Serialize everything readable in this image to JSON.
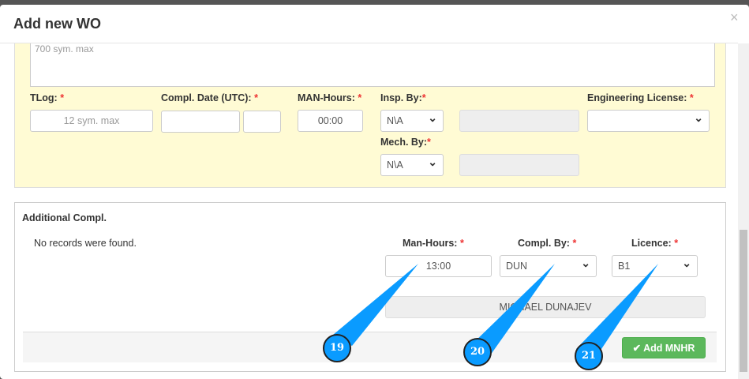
{
  "modal": {
    "title": "Add new WO",
    "close": "×"
  },
  "main": {
    "description_placeholder": "700 sym. max",
    "tlog": {
      "label": "TLog:",
      "req": "*",
      "placeholder": "12 sym. max"
    },
    "compl_date": {
      "label": "Compl. Date (UTC):",
      "req": "*"
    },
    "man_hours": {
      "label": "MAN-Hours:",
      "req": "*",
      "value": "00:00"
    },
    "insp_by": {
      "label": "Insp. By:",
      "req": "*",
      "value": "N\\A"
    },
    "mech_by": {
      "label": "Mech. By:",
      "req": "*",
      "value": "N\\A"
    },
    "eng_license": {
      "label": "Engineering License:",
      "req": "*",
      "value": ""
    }
  },
  "additional": {
    "title": "Additional Compl.",
    "empty": "No records were found.",
    "man_hours": {
      "label": "Man-Hours:",
      "req": "*",
      "value": "13:00"
    },
    "compl_by": {
      "label": "Compl. By:",
      "req": "*",
      "value": "DUN"
    },
    "licence": {
      "label": "Licence:",
      "req": "*",
      "value": "B1"
    },
    "name": "MICHAEL DUNAJEV",
    "add_button": "Add MNHR"
  },
  "callouts": [
    "19",
    "20",
    "21"
  ],
  "colors": {
    "callout": "#0a9bff",
    "button": "#5cb85c",
    "panel": "#fffbd4"
  }
}
